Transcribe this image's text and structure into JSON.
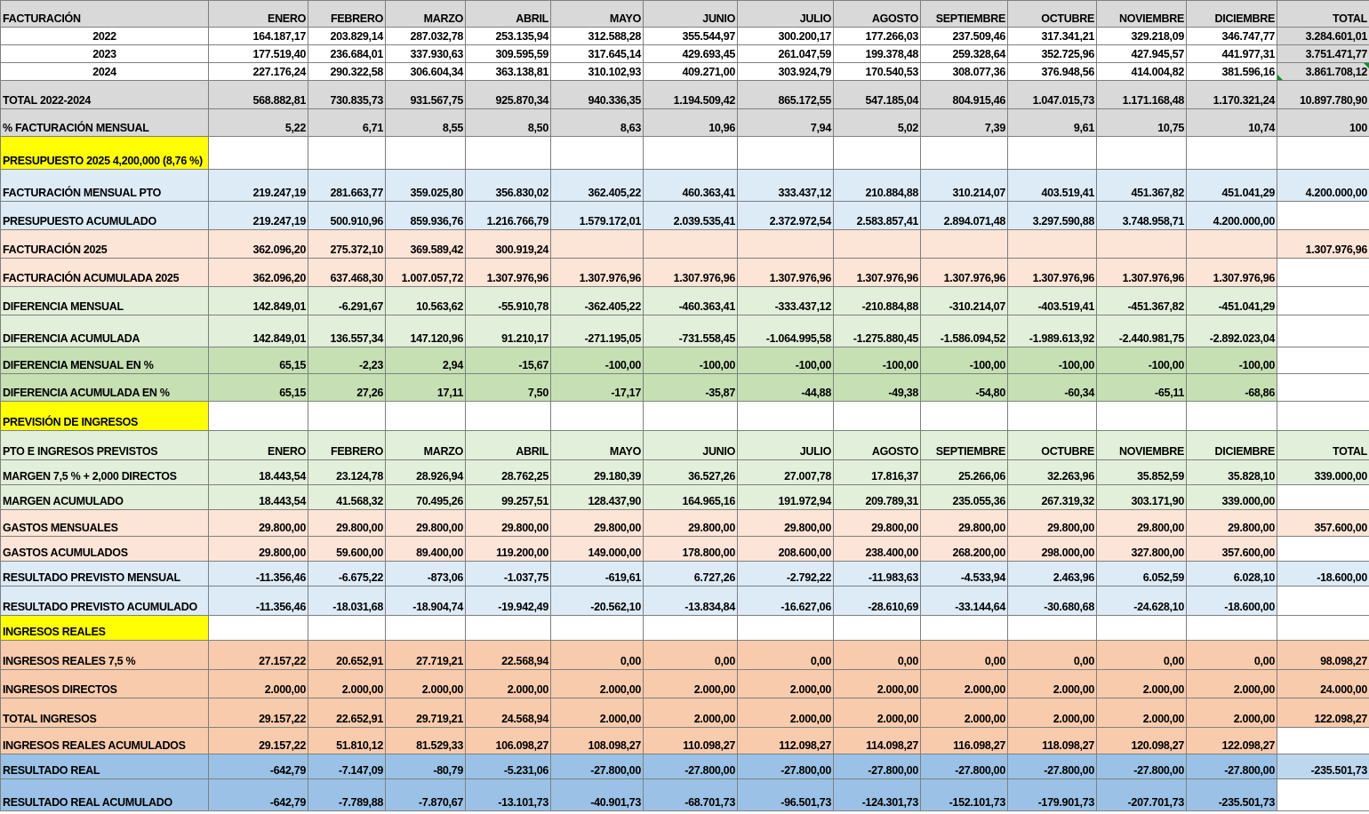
{
  "header": {
    "label": "FACTURACIÓN",
    "months": [
      "ENERO",
      "FEBRERO",
      "MARZO",
      "ABRIL",
      "MAYO",
      "JUNIO",
      "JULIO",
      "AGOSTO",
      "SEPTIEMBRE",
      "OCTUBRE",
      "NOVIEMBRE",
      "DICIEMBRE"
    ],
    "total": "TOTAL"
  },
  "colors": {
    "gray": "#d9d9d9",
    "blue": "#ddebf7",
    "peach": "#fce4d6",
    "light_green": "#e2efda",
    "mid_green": "#c6e0b4",
    "yellow": "#ffff00",
    "orange": "#f8cbad",
    "sky": "#9bc2e6"
  },
  "years": [
    {
      "label": "2022",
      "values": [
        "164.187,17",
        "203.829,14",
        "287.032,78",
        "253.135,94",
        "312.588,28",
        "355.544,97",
        "300.200,17",
        "177.266,03",
        "237.509,46",
        "317.341,21",
        "329.218,09",
        "346.747,77"
      ],
      "total": "3.284.601,01"
    },
    {
      "label": "2023",
      "values": [
        "177.519,40",
        "236.684,01",
        "337.930,63",
        "309.595,59",
        "317.645,14",
        "429.693,45",
        "261.047,59",
        "199.378,48",
        "259.328,64",
        "352.725,96",
        "427.945,57",
        "441.977,31"
      ],
      "total": "3.751.471,77"
    },
    {
      "label": "2024",
      "values": [
        "227.176,24",
        "290.322,58",
        "306.604,34",
        "363.138,81",
        "310.102,93",
        "409.271,00",
        "303.924,79",
        "170.540,53",
        "308.077,36",
        "376.948,56",
        "414.004,82",
        "381.596,16"
      ],
      "total": "3.861.708,12"
    }
  ],
  "total_2022_2024": {
    "label": "TOTAL 2022-2024",
    "values": [
      "568.882,81",
      "730.835,73",
      "931.567,75",
      "925.870,34",
      "940.336,35",
      "1.194.509,42",
      "865.172,55",
      "547.185,04",
      "804.915,46",
      "1.047.015,73",
      "1.171.168,48",
      "1.170.321,24"
    ],
    "total": "10.897.780,90"
  },
  "pct_facturacion": {
    "label": "% FACTURACIÓN MENSUAL",
    "values": [
      "5,22",
      "6,71",
      "8,55",
      "8,50",
      "8,63",
      "10,96",
      "7,94",
      "5,02",
      "7,39",
      "9,61",
      "10,75",
      "10,74"
    ],
    "total": "100"
  },
  "presupuesto_title": "PRESUPUESTO 2025 4,200,000 (8,76 %)",
  "facturacion_pto": {
    "label": "FACTURACIÓN MENSUAL PTO",
    "values": [
      "219.247,19",
      "281.663,77",
      "359.025,80",
      "356.830,02",
      "362.405,22",
      "460.363,41",
      "333.437,12",
      "210.884,88",
      "310.214,07",
      "403.519,41",
      "451.367,82",
      "451.041,29"
    ],
    "total": "4.200.000,00"
  },
  "presupuesto_acum": {
    "label": "PRESUPUESTO ACUMULADO",
    "values": [
      "219.247,19",
      "500.910,96",
      "859.936,76",
      "1.216.766,79",
      "1.579.172,01",
      "2.039.535,41",
      "2.372.972,54",
      "2.583.857,41",
      "2.894.071,48",
      "3.297.590,88",
      "3.748.958,71",
      "4.200.000,00"
    ],
    "total": ""
  },
  "facturacion_2025": {
    "label": "FACTURACIÓN 2025",
    "values": [
      "362.096,20",
      "275.372,10",
      "369.589,42",
      "300.919,24",
      "",
      "",
      "",
      "",
      "",
      "",
      "",
      ""
    ],
    "total": "1.307.976,96"
  },
  "facturacion_acum_2025": {
    "label": "FACTURACIÓN ACUMULADA 2025",
    "values": [
      "362.096,20",
      "637.468,30",
      "1.007.057,72",
      "1.307.976,96",
      "1.307.976,96",
      "1.307.976,96",
      "1.307.976,96",
      "1.307.976,96",
      "1.307.976,96",
      "1.307.976,96",
      "1.307.976,96",
      "1.307.976,96"
    ],
    "total": ""
  },
  "diferencia_mensual": {
    "label": "DIFERENCIA MENSUAL",
    "values": [
      "142.849,01",
      "-6.291,67",
      "10.563,62",
      "-55.910,78",
      "-362.405,22",
      "-460.363,41",
      "-333.437,12",
      "-210.884,88",
      "-310.214,07",
      "-403.519,41",
      "-451.367,82",
      "-451.041,29"
    ],
    "total": ""
  },
  "diferencia_acum": {
    "label": "DIFERENCIA ACUMULADA",
    "values": [
      "142.849,01",
      "136.557,34",
      "147.120,96",
      "91.210,17",
      "-271.195,05",
      "-731.558,45",
      "-1.064.995,58",
      "-1.275.880,45",
      "-1.586.094,52",
      "-1.989.613,92",
      "-2.440.981,75",
      "-2.892.023,04"
    ],
    "total": ""
  },
  "diferencia_mensual_pct": {
    "label": "DIFERENCIA MENSUAL EN %",
    "values": [
      "65,15",
      "-2,23",
      "2,94",
      "-15,67",
      "-100,00",
      "-100,00",
      "-100,00",
      "-100,00",
      "-100,00",
      "-100,00",
      "-100,00",
      "-100,00"
    ],
    "total": ""
  },
  "diferencia_acum_pct": {
    "label": "DIFERENCIA ACUMULADA EN %",
    "values": [
      "65,15",
      "27,26",
      "17,11",
      "7,50",
      "-17,17",
      "-35,87",
      "-44,88",
      "-49,38",
      "-54,80",
      "-60,34",
      "-65,11",
      "-68,86"
    ],
    "total": ""
  },
  "prevision_title": "PREVISIÓN DE INGRESOS",
  "pto_header": {
    "label": "PTO E INGRESOS PREVISTOS",
    "values": [
      "ENERO",
      "FEBRERO",
      "MARZO",
      "ABRIL",
      "MAYO",
      "JUNIO",
      "JULIO",
      "AGOSTO",
      "SEPTIEMBRE",
      "OCTUBRE",
      "NOVIEMBRE",
      "DICIEMBRE"
    ],
    "total": "TOTAL"
  },
  "margen": {
    "label": "MARGEN  7,5 % + 2,000 DIRECTOS",
    "values": [
      "18.443,54",
      "23.124,78",
      "28.926,94",
      "28.762,25",
      "29.180,39",
      "36.527,26",
      "27.007,78",
      "17.816,37",
      "25.266,06",
      "32.263,96",
      "35.852,59",
      "35.828,10"
    ],
    "total": "339.000,00"
  },
  "margen_acum": {
    "label": "MARGEN  ACUMULADO",
    "values": [
      "18.443,54",
      "41.568,32",
      "70.495,26",
      "99.257,51",
      "128.437,90",
      "164.965,16",
      "191.972,94",
      "209.789,31",
      "235.055,36",
      "267.319,32",
      "303.171,90",
      "339.000,00"
    ],
    "total": ""
  },
  "gastos_mensuales": {
    "label": "GASTOS MENSUALES",
    "values": [
      "29.800,00",
      "29.800,00",
      "29.800,00",
      "29.800,00",
      "29.800,00",
      "29.800,00",
      "29.800,00",
      "29.800,00",
      "29.800,00",
      "29.800,00",
      "29.800,00",
      "29.800,00"
    ],
    "total": "357.600,00"
  },
  "gastos_acum": {
    "label": "GASTOS ACUMULADOS",
    "values": [
      "29.800,00",
      "59.600,00",
      "89.400,00",
      "119.200,00",
      "149.000,00",
      "178.800,00",
      "208.600,00",
      "238.400,00",
      "268.200,00",
      "298.000,00",
      "327.800,00",
      "357.600,00"
    ],
    "total": ""
  },
  "resultado_mensual": {
    "label": "RESULTADO PREVISTO MENSUAL",
    "values": [
      "-11.356,46",
      "-6.675,22",
      "-873,06",
      "-1.037,75",
      "-619,61",
      "6.727,26",
      "-2.792,22",
      "-11.983,63",
      "-4.533,94",
      "2.463,96",
      "6.052,59",
      "6.028,10"
    ],
    "total": "-18.600,00"
  },
  "resultado_acum": {
    "label": "RESULTADO PREVISTO ACUMULADO",
    "values": [
      "-11.356,46",
      "-18.031,68",
      "-18.904,74",
      "-19.942,49",
      "-20.562,10",
      "-13.834,84",
      "-16.627,06",
      "-28.610,69",
      "-33.144,64",
      "-30.680,68",
      "-24.628,10",
      "-18.600,00"
    ],
    "total": ""
  },
  "ingresos_title": "INGRESOS REALES",
  "ingresos_reales": {
    "label": "INGRESOS REALES 7,5 %",
    "values": [
      "27.157,22",
      "20.652,91",
      "27.719,21",
      "22.568,94",
      "0,00",
      "0,00",
      "0,00",
      "0,00",
      "0,00",
      "0,00",
      "0,00",
      "0,00"
    ],
    "total": "98.098,27"
  },
  "ingresos_directos": {
    "label": "INGRESOS DIRECTOS",
    "values": [
      "2.000,00",
      "2.000,00",
      "2.000,00",
      "2.000,00",
      "2.000,00",
      "2.000,00",
      "2.000,00",
      "2.000,00",
      "2.000,00",
      "2.000,00",
      "2.000,00",
      "2.000,00"
    ],
    "total": "24.000,00"
  },
  "total_ingresos": {
    "label": "TOTAL INGRESOS",
    "values": [
      "29.157,22",
      "22.652,91",
      "29.719,21",
      "24.568,94",
      "2.000,00",
      "2.000,00",
      "2.000,00",
      "2.000,00",
      "2.000,00",
      "2.000,00",
      "2.000,00",
      "2.000,00"
    ],
    "total": "122.098,27"
  },
  "ingresos_acum": {
    "label": "INGRESOS REALES ACUMULADOS",
    "values": [
      "29.157,22",
      "51.810,12",
      "81.529,33",
      "106.098,27",
      "108.098,27",
      "110.098,27",
      "112.098,27",
      "114.098,27",
      "116.098,27",
      "118.098,27",
      "120.098,27",
      "122.098,27"
    ],
    "total": ""
  },
  "resultado_real": {
    "label": "RESULTADO REAL",
    "values": [
      "-642,79",
      "-7.147,09",
      "-80,79",
      "-5.231,06",
      "-27.800,00",
      "-27.800,00",
      "-27.800,00",
      "-27.800,00",
      "-27.800,00",
      "-27.800,00",
      "-27.800,00",
      "-27.800,00"
    ],
    "total": "-235.501,73"
  },
  "resultado_real_acum": {
    "label": "RESULTADO REAL ACUMULADO",
    "values": [
      "-642,79",
      "-7.789,88",
      "-7.870,67",
      "-13.101,73",
      "-40.901,73",
      "-68.701,73",
      "-96.501,73",
      "-124.301,73",
      "-152.101,73",
      "-179.901,73",
      "-207.701,73",
      "-235.501,73"
    ],
    "total": ""
  }
}
